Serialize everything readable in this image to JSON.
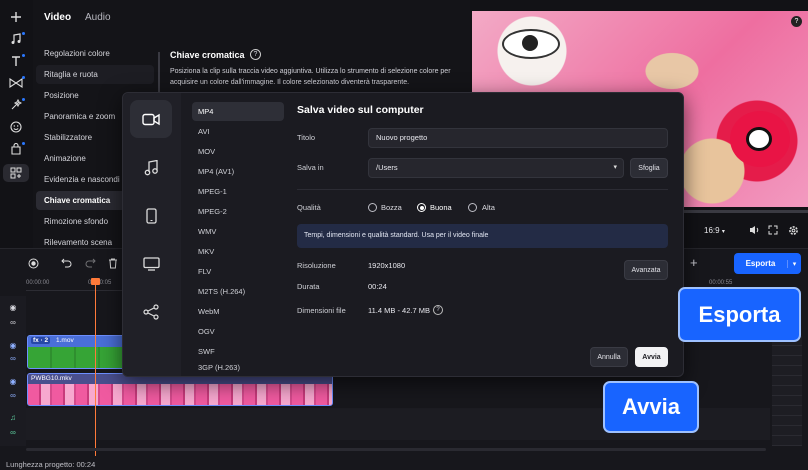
{
  "sidebar_icons": [
    {
      "name": "add-icon"
    },
    {
      "name": "music-icon"
    },
    {
      "name": "text-icon"
    },
    {
      "name": "transitions-icon"
    },
    {
      "name": "effects-icon"
    },
    {
      "name": "stickers-icon"
    },
    {
      "name": "store-icon"
    },
    {
      "name": "templates-icon"
    }
  ],
  "props": {
    "tabs": [
      "Video",
      "Audio"
    ],
    "menu": [
      "Regolazioni colore",
      "Ritaglia e ruota",
      "Posizione",
      "Panoramica e zoom",
      "Stabilizzatore",
      "Animazione",
      "Evidenzia e nascondi",
      "Chiave cromatica",
      "Rimozione sfondo",
      "Rilevamento scena"
    ],
    "active_item": "Chiave cromatica",
    "section_title": "Chiave cromatica",
    "help_glyph": "?",
    "description": "Posiziona la clip sulla traccia video aggiuntiva. Utilizza lo strumento di selezione colore per acquisire un colore dall'immagine. Il colore selezionato diventerà trasparente."
  },
  "preview": {
    "ratio": "16:9"
  },
  "timeline": {
    "time_start": "00:00:00",
    "time_mark": "00:00:05",
    "time_right": "00:00:55",
    "clip1_badge": "fx · 2",
    "clip1_name": "1.mov",
    "clip2_name": "PWBG10.mkv",
    "project_length": "Lunghezza progetto: 00:24"
  },
  "export_button": "Esporta",
  "dialog": {
    "title": "Salva video sul computer",
    "formats": [
      "MP4",
      "AVI",
      "MOV",
      "MP4 (AV1)",
      "MPEG-1",
      "MPEG-2",
      "WMV",
      "MKV",
      "FLV",
      "M2TS (H.264)",
      "WebM",
      "OGV",
      "SWF",
      "3GP (H.263)"
    ],
    "selected_format": "MP4",
    "title_label": "Titolo",
    "title_value": "Nuovo progetto",
    "save_label": "Salva in",
    "save_value": "/Users",
    "browse": "Sfoglia",
    "quality_label": "Qualità",
    "quality_options": [
      "Bozza",
      "Buona",
      "Alta"
    ],
    "quality_selected": "Buona",
    "quality_note": "Tempi, dimensioni e qualità standard. Usa per il video finale",
    "resolution_label": "Risoluzione",
    "resolution_value": "1920x1080",
    "advanced": "Avanzata",
    "duration_label": "Durata",
    "duration_value": "00:24",
    "filesize_label": "Dimensioni file",
    "filesize_value": "11.4 MB - 42.7 MB",
    "cancel": "Annulla",
    "start": "Avvia"
  },
  "callouts": {
    "export": "Esporta",
    "start": "Avvia"
  },
  "colors": {
    "accent": "#1864ff",
    "dialog_bg": "#1b1b21",
    "clip_green": "#3a9e3a",
    "clip_pink": "#e84f9a"
  }
}
